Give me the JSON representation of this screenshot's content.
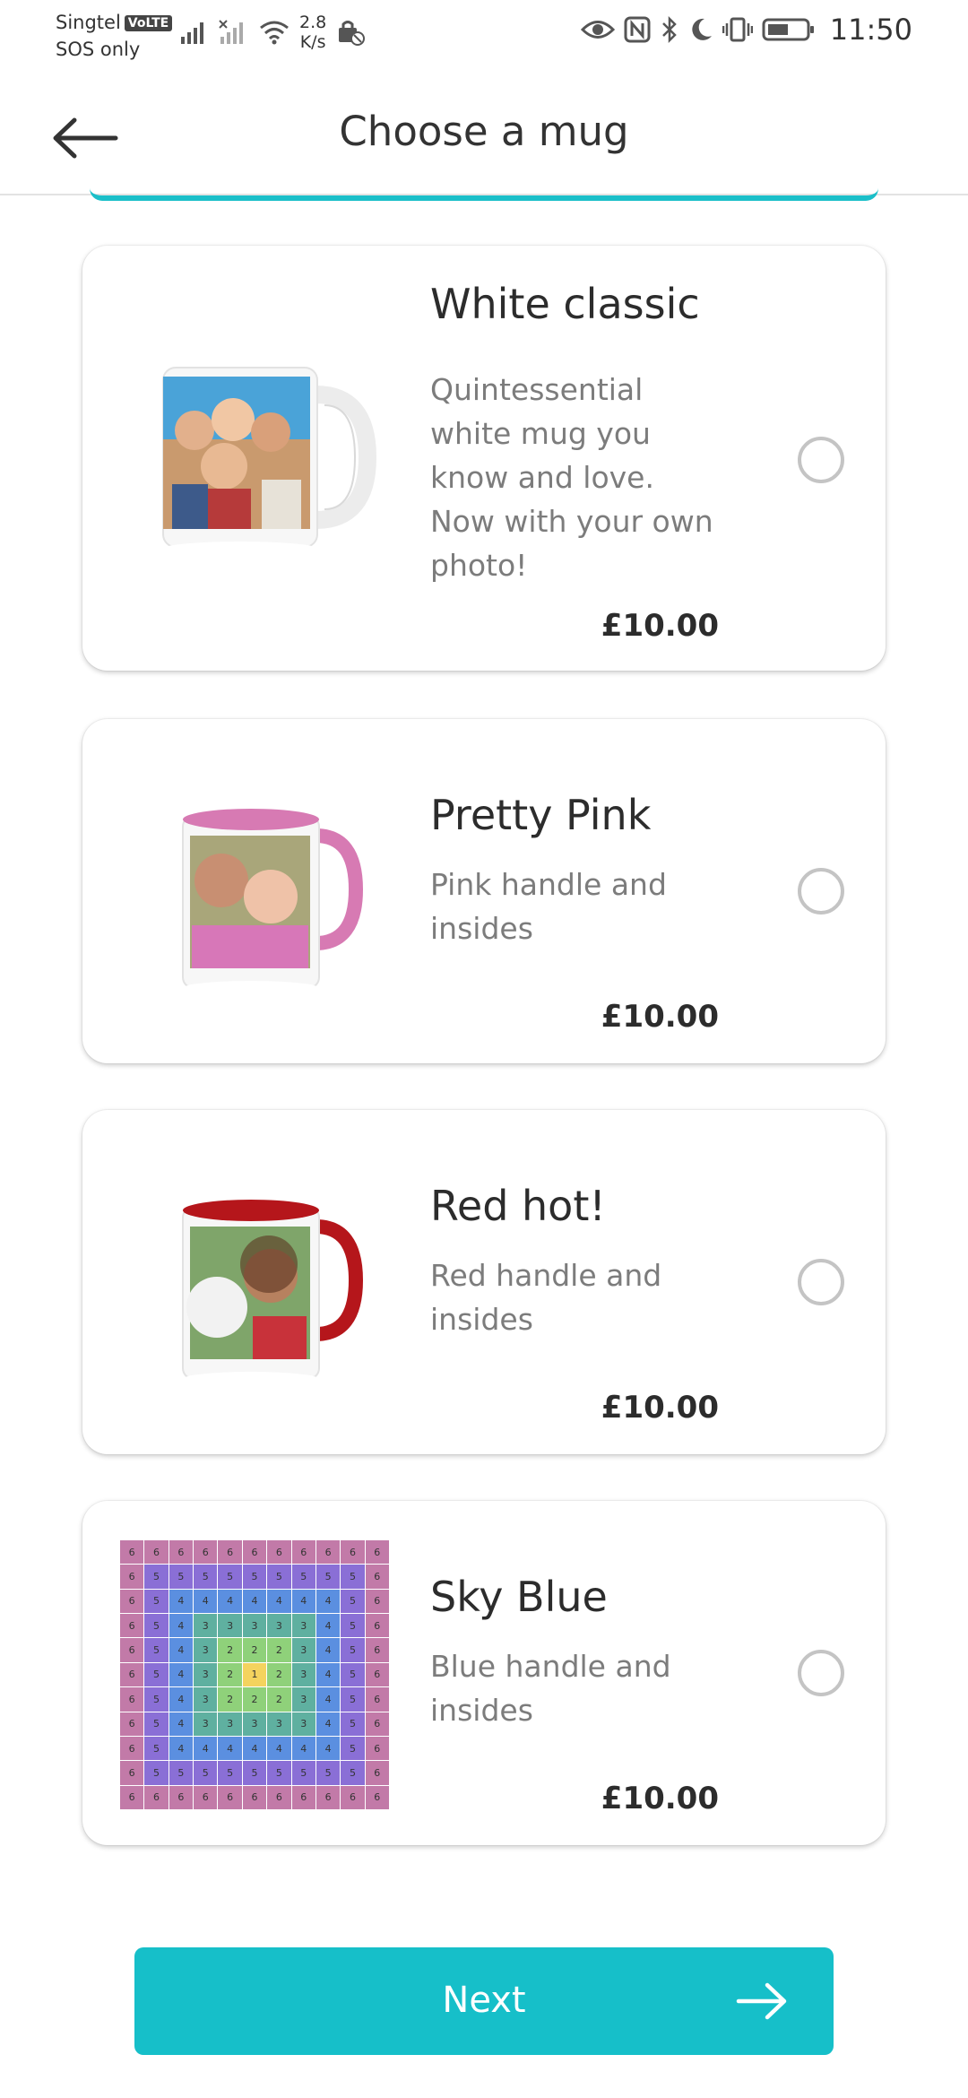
{
  "status_bar": {
    "carrier": "Singtel",
    "volte": "VoLTE",
    "sos": "SOS only",
    "speed_value": "2.8",
    "speed_unit": "K/s",
    "time": "11:50"
  },
  "header": {
    "title": "Choose a mug"
  },
  "mugs": [
    {
      "name": "White classic",
      "description": "Quintessential white mug you know and love. Now with your own photo!",
      "price": "£10.00",
      "handle_color": "#f2f2f2",
      "rim_color": "#ffffff"
    },
    {
      "name": "Pretty Pink",
      "description": "Pink handle and insides",
      "price": "£10.00",
      "handle_color": "#d77ab3",
      "rim_color": "#d77ab3"
    },
    {
      "name": "Red hot!",
      "description": "Red handle and insides",
      "price": "£10.00",
      "handle_color": "#b5161b",
      "rim_color": "#b5161b"
    },
    {
      "name": "Sky Blue",
      "description": "Blue handle and insides",
      "price": "£10.00",
      "placeholder_grid": [
        [
          6,
          6,
          6,
          6,
          6,
          6,
          6,
          6,
          6,
          6,
          6
        ],
        [
          6,
          5,
          5,
          5,
          5,
          5,
          5,
          5,
          5,
          5,
          6
        ],
        [
          6,
          5,
          4,
          4,
          4,
          4,
          4,
          4,
          4,
          5,
          6
        ],
        [
          6,
          5,
          4,
          3,
          3,
          3,
          3,
          3,
          4,
          5,
          6
        ],
        [
          6,
          5,
          4,
          3,
          2,
          2,
          2,
          3,
          4,
          5,
          6
        ],
        [
          6,
          5,
          4,
          3,
          2,
          1,
          2,
          3,
          4,
          5,
          6
        ],
        [
          6,
          5,
          4,
          3,
          2,
          2,
          2,
          3,
          4,
          5,
          6
        ],
        [
          6,
          5,
          4,
          3,
          3,
          3,
          3,
          3,
          4,
          5,
          6
        ],
        [
          6,
          5,
          4,
          4,
          4,
          4,
          4,
          4,
          4,
          5,
          6
        ],
        [
          6,
          5,
          5,
          5,
          5,
          5,
          5,
          5,
          5,
          5,
          6
        ],
        [
          6,
          6,
          6,
          6,
          6,
          6,
          6,
          6,
          6,
          6,
          6
        ]
      ],
      "grid_colors": {
        "1": "#f4d35e",
        "2": "#8fd17a",
        "3": "#5fb0a0",
        "4": "#5b8fe0",
        "5": "#8a6fd6",
        "6": "#c27aa8"
      }
    }
  ],
  "next_button": {
    "label": "Next"
  },
  "colors": {
    "accent": "#16bfc9",
    "radio_border": "#c4c4c4"
  }
}
